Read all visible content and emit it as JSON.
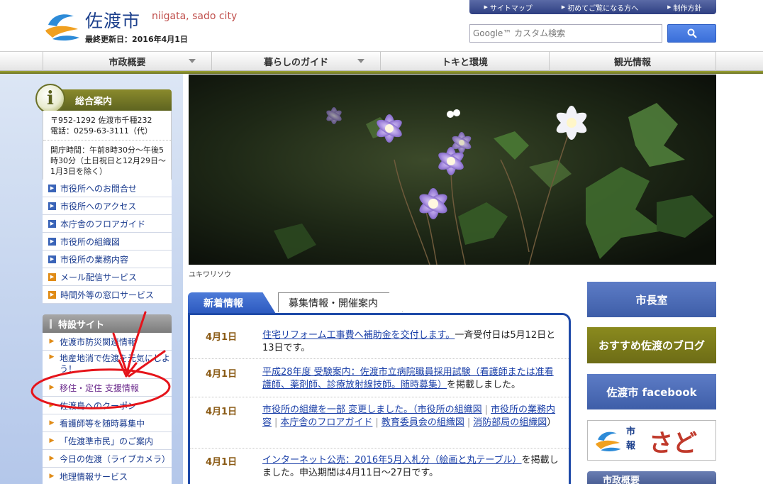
{
  "header": {
    "site_name": "佐渡市",
    "site_name_en": "niigata, sado city",
    "last_updated": "最終更新日：2016年4月1日",
    "util_links": [
      "サイトマップ",
      "初めてご覧になる方へ",
      "制作方針"
    ],
    "search": {
      "placeholder": "Google™ カスタム検索",
      "button_icon": "search-icon"
    }
  },
  "nav": {
    "items": [
      {
        "label": "市政概要",
        "dropdown": true
      },
      {
        "label": "暮らしのガイド",
        "dropdown": true
      },
      {
        "label": "トキと環境",
        "dropdown": false
      },
      {
        "label": "観光情報",
        "dropdown": false
      }
    ]
  },
  "info": {
    "title": "総合案内",
    "address": "〒952-1292 佐渡市千種232",
    "phone": "電話：0259-63-3111（代）",
    "hours": "開庁時間：午前8時30分～午後5時30分（土日祝日と12月29日～1月3日を除く）",
    "links": [
      {
        "label": "市役所へのお問合せ",
        "style": "blue"
      },
      {
        "label": "市役所へのアクセス",
        "style": "blue"
      },
      {
        "label": "本庁舎のフロアガイド",
        "style": "blue"
      },
      {
        "label": "市役所の組織図",
        "style": "blue"
      },
      {
        "label": "市役所の業務内容",
        "style": "blue"
      },
      {
        "label": "メール配信サービス",
        "style": "orange"
      },
      {
        "label": "時間外等の窓口サービス",
        "style": "orange"
      }
    ]
  },
  "special": {
    "title": "特設サイト",
    "links": [
      {
        "label": "佐渡市防災関連情報"
      },
      {
        "label": "地産地消で佐渡を元気にしよう！"
      },
      {
        "label": "移住・定住 支援情報"
      },
      {
        "label": "佐渡島へのクーポン"
      },
      {
        "label": "看護師等を随時募集中"
      },
      {
        "label": "「佐渡準市民」のご案内"
      },
      {
        "label": "今日の佐渡（ライブカメラ）"
      },
      {
        "label": "地理情報サービス"
      }
    ]
  },
  "hero": {
    "caption": "ユキワリソウ"
  },
  "news": {
    "tabs": [
      "新着情報",
      "募集情報・開催案内"
    ],
    "items": [
      {
        "date": "4月1日",
        "link": "住宅リフォーム工事費へ補助金を交付します。",
        "text": "一斉受付日は5月12日と13日です。"
      },
      {
        "date": "4月1日",
        "link": "平成28年度 受験案内：佐渡市立病院職員採用試験（看護師または准看護師、薬剤師、診療放射線技師。随時募集）",
        "text": "を掲載しました。"
      },
      {
        "date": "4月1日",
        "link": "市役所の組織を一部 変更しました。（市役所の組織図",
        "sublinks": [
          "市役所の業務内容",
          "本庁舎のフロアガイド",
          "教育委員会の組織図",
          "消防部局の組織図"
        ],
        "text": "）"
      },
      {
        "date": "4月1日",
        "link": "インターネット公売：2016年5月入札分（絵画と丸テーブル）",
        "text": "を掲載しました。申込期間は4月11日～27日です。"
      }
    ]
  },
  "right": {
    "mayor": "市長室",
    "blog": "おすすめ佐渡のブログ",
    "facebook": "佐渡市 facebook",
    "koho_label": "市報",
    "koho_big": "さど",
    "section_head": "市政概要"
  },
  "colors": {
    "brand_blue": "#1b3f8c",
    "accent_olive": "#7b7f24",
    "link": "#1a3fa8",
    "annotation_red": "#e5141b"
  }
}
